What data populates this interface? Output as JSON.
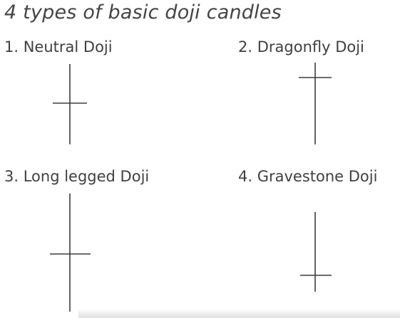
{
  "title": "4 types of basic doji candles",
  "candles": [
    {
      "label": "1. Neutral Doji"
    },
    {
      "label": "2. Dragonfly Doji"
    },
    {
      "label": "3. Long legged Doji"
    },
    {
      "label": "4. Gravestone Doji"
    }
  ],
  "colors": {
    "text": "#3f3f3f",
    "candle_stroke": "#3d3d3d",
    "background": "#ffffff"
  }
}
